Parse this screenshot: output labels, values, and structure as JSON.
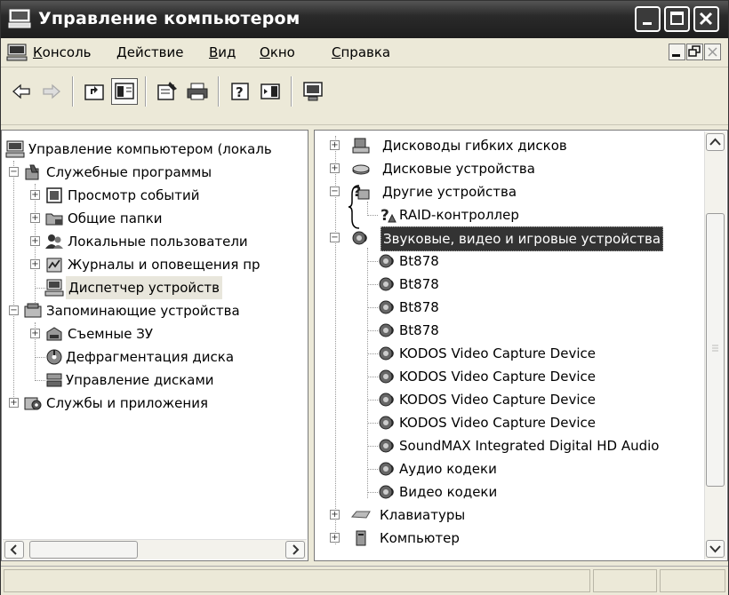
{
  "window": {
    "title": "Управление компьютером"
  },
  "menu": {
    "items": [
      {
        "u": "К",
        "rest": "онсоль"
      },
      {
        "u": "Д",
        "rest": "ействие"
      },
      {
        "u": "В",
        "rest": "ид"
      },
      {
        "u": "О",
        "rest": "кно"
      },
      {
        "u": "С",
        "rest": "правка"
      }
    ]
  },
  "toolbar": {
    "icons": [
      "back-arrow-icon",
      "forward-arrow-icon",
      "up-folder-icon",
      "show-hide-tree-icon",
      "properties-icon",
      "print-icon",
      "help-icon",
      "action-pane-icon",
      "monitor-icon"
    ]
  },
  "left_tree": [
    {
      "label": "Управление компьютером (локаль",
      "icon": "computer-icon"
    },
    {
      "label": "Служебные программы",
      "icon": "tools-icon"
    },
    {
      "label": "Просмотр событий",
      "icon": "event-viewer-icon"
    },
    {
      "label": "Общие папки",
      "icon": "shared-folder-icon"
    },
    {
      "label": "Локальные пользователи",
      "icon": "users-icon"
    },
    {
      "label": "Журналы и оповещения пр",
      "icon": "logs-icon"
    },
    {
      "label": "Диспетчер устройств",
      "icon": "device-manager-icon"
    },
    {
      "label": "Запоминающие устройства",
      "icon": "storage-icon"
    },
    {
      "label": "Съемные ЗУ",
      "icon": "removable-storage-icon"
    },
    {
      "label": "Дефрагментация диска",
      "icon": "defrag-icon"
    },
    {
      "label": "Управление дисками",
      "icon": "disk-management-icon"
    },
    {
      "label": "Службы и приложения",
      "icon": "services-icon"
    }
  ],
  "right_tree": [
    {
      "label": "Дисководы гибких дисков",
      "icon": "floppy-icon"
    },
    {
      "label": "Дисковые устройства",
      "icon": "disk-drive-icon"
    },
    {
      "label": "Другие устройства",
      "icon": "unknown-device-icon"
    },
    {
      "label": "RAID-контроллер",
      "icon": "unknown-device-warning-icon"
    },
    {
      "label": "Звуковые, видео и игровые устройства",
      "icon": "sound-icon"
    },
    {
      "label": "Bt878",
      "icon": "sound-icon"
    },
    {
      "label": "Bt878",
      "icon": "sound-icon"
    },
    {
      "label": "Bt878",
      "icon": "sound-icon"
    },
    {
      "label": "Bt878",
      "icon": "sound-icon"
    },
    {
      "label": "KODOS Video Capture Device",
      "icon": "sound-icon"
    },
    {
      "label": "KODOS Video Capture Device",
      "icon": "sound-icon"
    },
    {
      "label": "KODOS Video Capture Device",
      "icon": "sound-icon"
    },
    {
      "label": "KODOS Video Capture Device",
      "icon": "sound-icon"
    },
    {
      "label": "SoundMAX Integrated Digital HD Audio",
      "icon": "sound-icon"
    },
    {
      "label": "Аудио кодеки",
      "icon": "sound-icon"
    },
    {
      "label": "Видео кодеки",
      "icon": "sound-icon"
    },
    {
      "label": "Клавиатуры",
      "icon": "keyboard-icon"
    },
    {
      "label": "Компьютер",
      "icon": "computer-icon"
    }
  ],
  "colors": {
    "titlebar": "#2a2a2a",
    "selection": "#333333",
    "face": "#ece9d8"
  }
}
